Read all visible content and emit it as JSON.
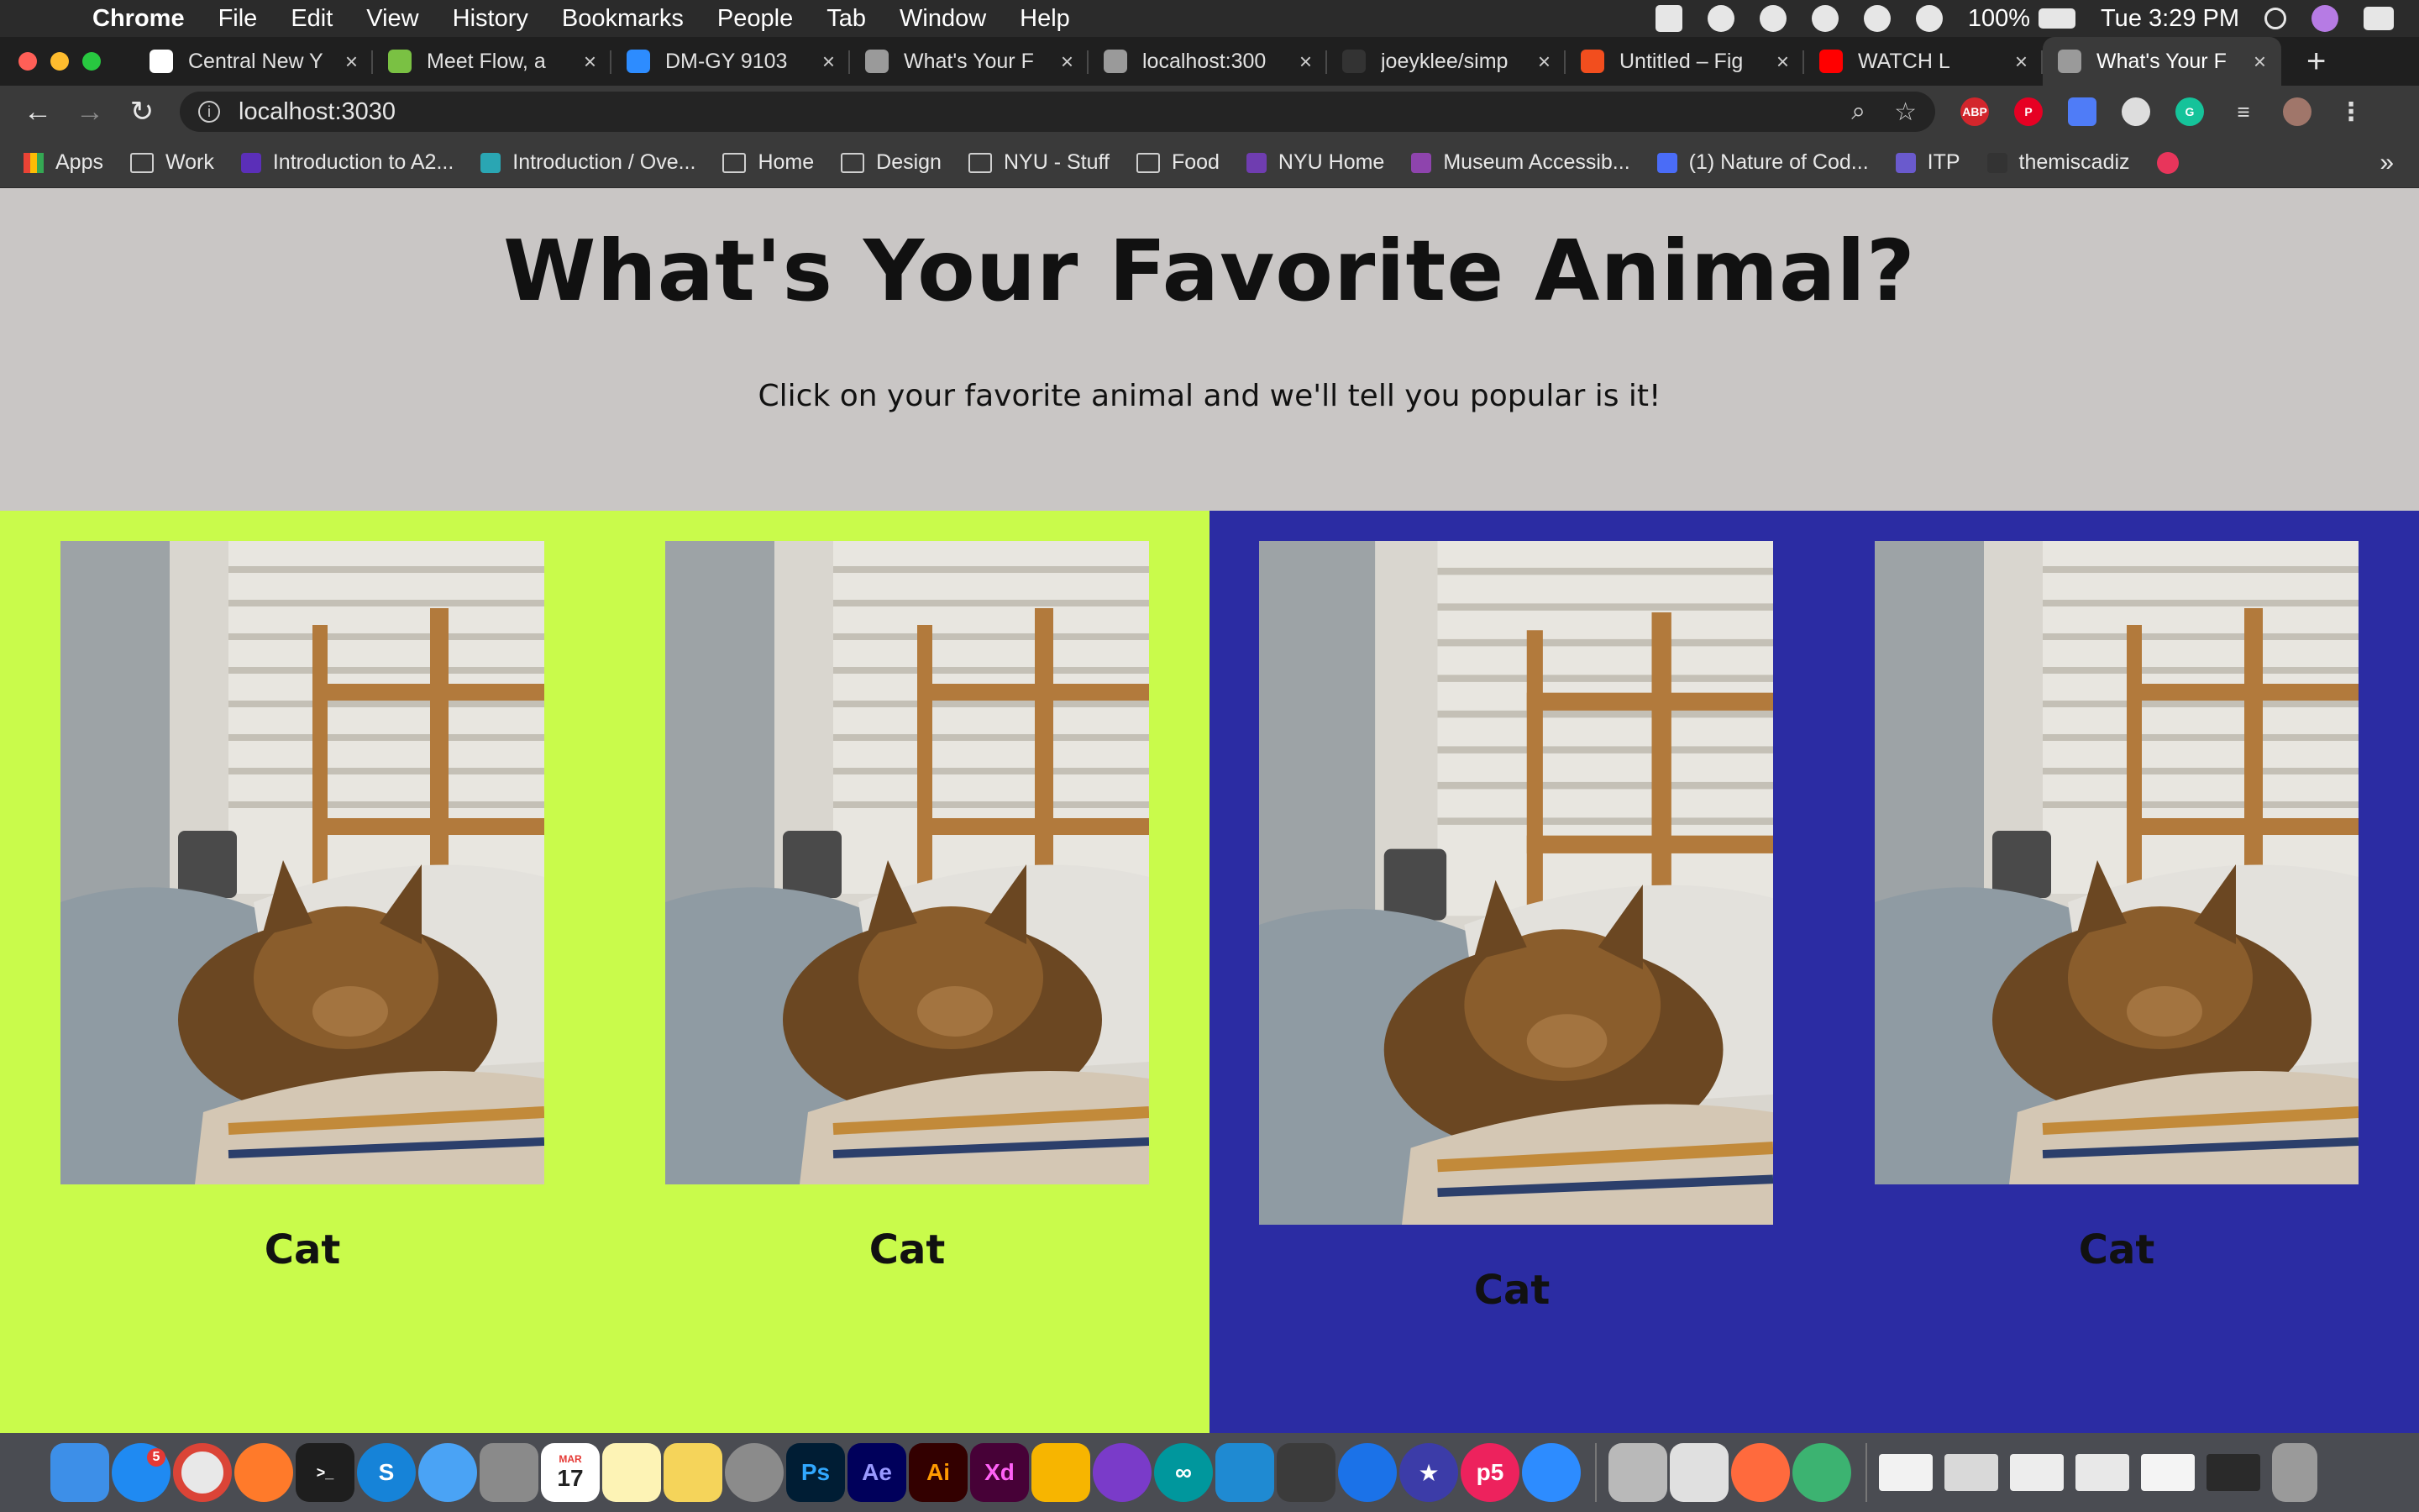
{
  "menubar": {
    "app_name": "Chrome",
    "items": [
      "File",
      "Edit",
      "View",
      "History",
      "Bookmarks",
      "People",
      "Tab",
      "Window",
      "Help"
    ],
    "battery": "100%",
    "clock": "Tue 3:29 PM"
  },
  "tabs": [
    {
      "title": "Central New Y",
      "color": "#ffffff"
    },
    {
      "title": "Meet Flow, a",
      "color": "#7ac143"
    },
    {
      "title": "DM-GY 9103",
      "color": "#2d8cff"
    },
    {
      "title": "What's Your F",
      "color": "#9a9a9a"
    },
    {
      "title": "localhost:300",
      "color": "#9a9a9a"
    },
    {
      "title": "joeyklee/simp",
      "color": "#333333"
    },
    {
      "title": "Untitled – Fig",
      "color": "#f24e1e"
    },
    {
      "title": "WATCH L",
      "color": "#ff0000"
    },
    {
      "title": "What's Your F",
      "color": "#9a9a9a",
      "active": true
    }
  ],
  "toolbar": {
    "url": "localhost:3030"
  },
  "bookmarks": [
    {
      "label": "Apps",
      "type": "apps"
    },
    {
      "label": "Work",
      "type": "folder"
    },
    {
      "label": "Introduction to A2...",
      "type": "site"
    },
    {
      "label": "Introduction / Ove...",
      "type": "site"
    },
    {
      "label": "Home",
      "type": "folder"
    },
    {
      "label": "Design",
      "type": "folder"
    },
    {
      "label": "NYU - Stuff",
      "type": "folder"
    },
    {
      "label": "Food",
      "type": "folder"
    },
    {
      "label": "NYU Home",
      "type": "site"
    },
    {
      "label": "Museum Accessib...",
      "type": "site"
    },
    {
      "label": "(1) Nature of Cod...",
      "type": "site"
    },
    {
      "label": "ITP",
      "type": "site"
    },
    {
      "label": "themiscadiz",
      "type": "site"
    }
  ],
  "page": {
    "title": "What's Your Favorite Animal?",
    "subtitle": "Click on your favorite animal and we'll tell you popular is it!",
    "cards": [
      {
        "label": "Cat",
        "background": "#c9fb4b"
      },
      {
        "label": "Cat",
        "background": "#c9fb4b"
      },
      {
        "label": "Cat",
        "background": "#2b2ca3"
      },
      {
        "label": "Cat",
        "background": "#2b2ca3"
      }
    ]
  },
  "dock": {
    "badges": {
      "app_store": "5"
    },
    "calendar_month": "MAR",
    "calendar_day": "17"
  }
}
